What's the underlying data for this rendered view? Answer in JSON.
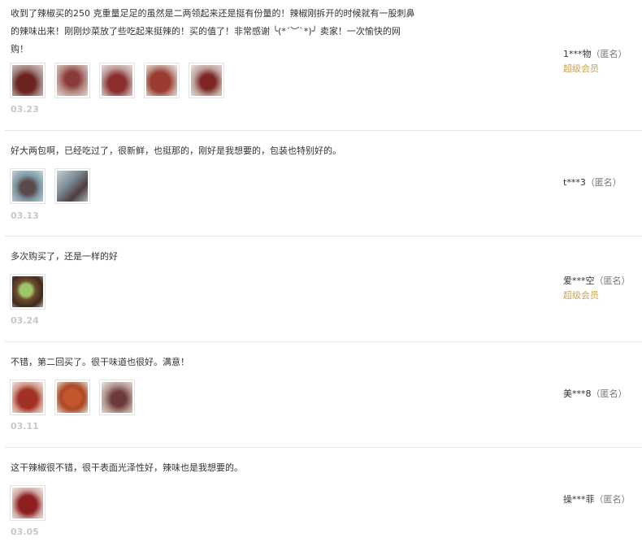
{
  "reviews": [
    {
      "text": "收到了辣椒买的250 克重量足足的虽然是二两领起来还是挺有份量的！辣椒刚拆开的时候就有一股刺鼻的辣味出来！刚刚炒菜放了些吃起来挺辣的！买的值了！非常感谢 ╰(*´︶`*)╯ 卖家！一次愉快的网购！",
      "date": "03.23",
      "user": {
        "name": "1***物",
        "anon": "（匿名）",
        "vip": "超级会员"
      },
      "photos": [
        "chili-photo",
        "chili-photo",
        "chili-photo",
        "chili-photo",
        "chili-photo"
      ]
    },
    {
      "text": "好大两包啊，已经吃过了，很新鲜，也挺那的，刚好是我想要的，包装也特别好的。",
      "date": "03.13",
      "user": {
        "name": "t***3",
        "anon": "（匿名）",
        "vip": ""
      },
      "photos": [
        "chili-bag-photo",
        "chili-bag-photo"
      ]
    },
    {
      "text": "多次购买了，还是一样的好",
      "date": "03.24",
      "user": {
        "name": "爱***空",
        "anon": "（匿名）",
        "vip": "超级会员"
      },
      "photos": [
        "dish-photo"
      ]
    },
    {
      "text": "不错，第二回买了。很干味道也很好。满意！",
      "date": "03.11",
      "user": {
        "name": "美***8",
        "anon": "（匿名）",
        "vip": ""
      },
      "photos": [
        "chili-photo",
        "chili-photo",
        "chili-photo"
      ]
    },
    {
      "text": "这干辣椒很不错，很干表面光泽性好，辣味也是我想要的。",
      "date": "03.05",
      "user": {
        "name": "操***菲",
        "anon": "（匿名）",
        "vip": ""
      },
      "photos": [
        "chili-photo"
      ]
    }
  ],
  "colors": {
    "vip": "#c9a454",
    "date": "#c7c7c7",
    "divider": "#e6e6e6"
  }
}
